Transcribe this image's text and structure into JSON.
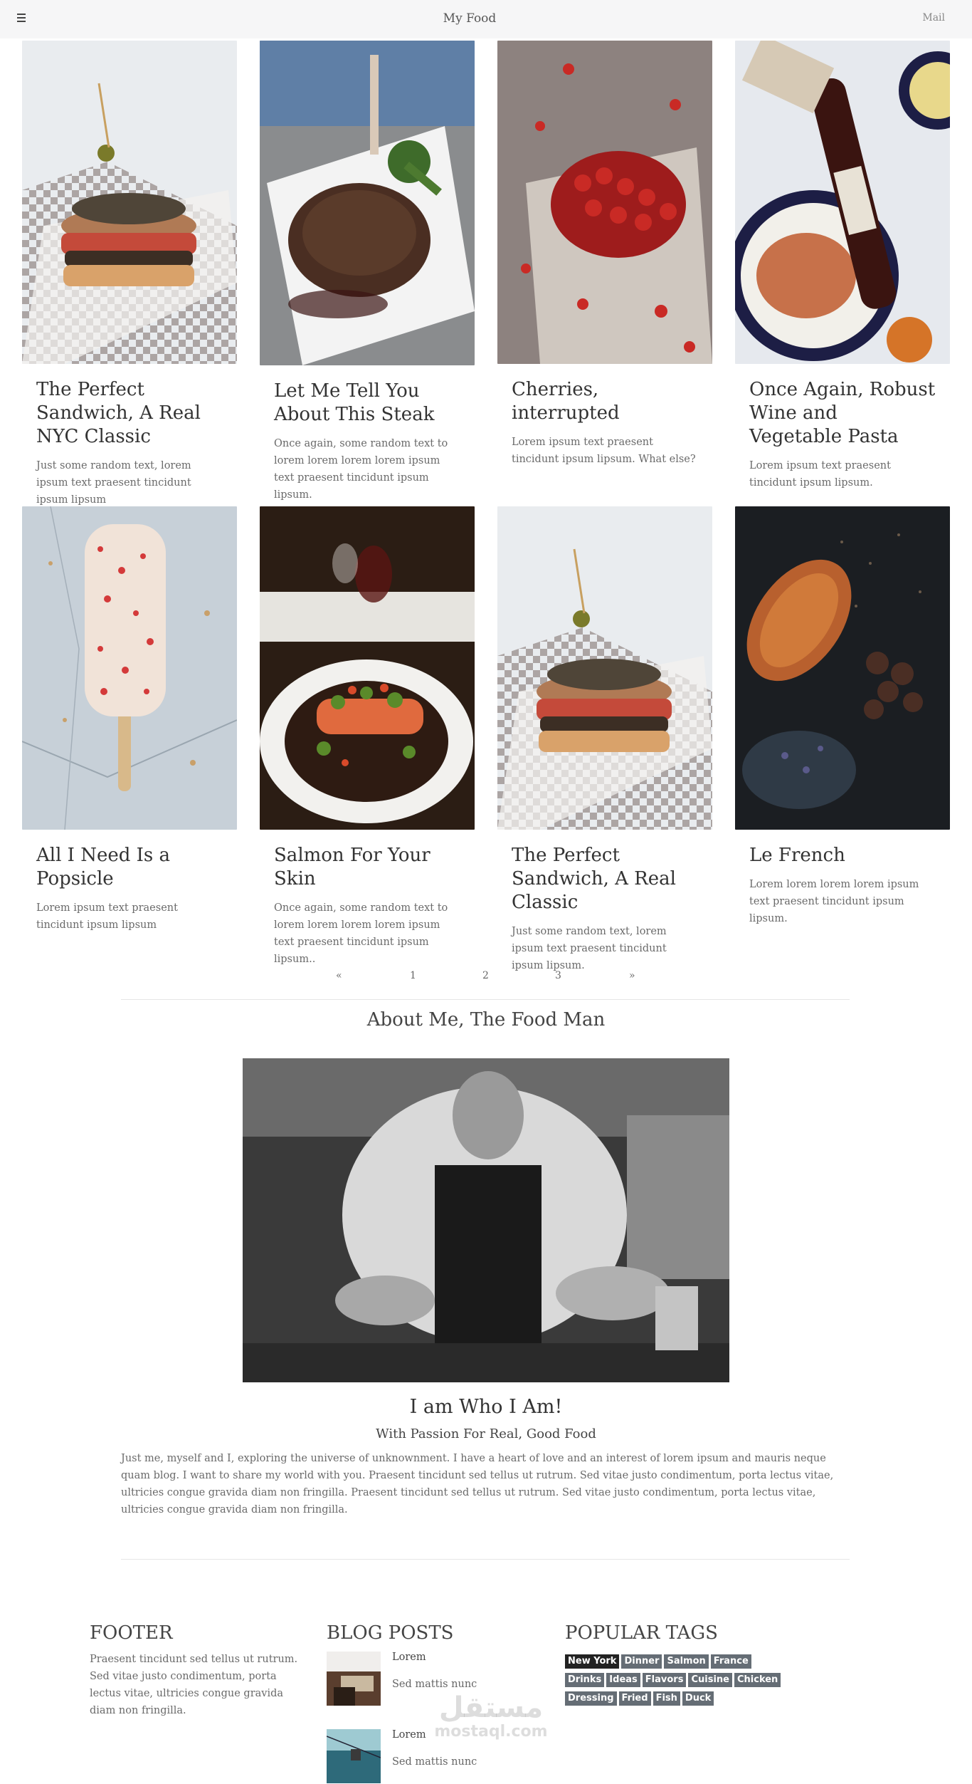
{
  "header": {
    "menu_icon": "hamburger-icon",
    "title": "My Food",
    "mail_label": "Mail"
  },
  "cards": [
    {
      "title": "The Perfect Sandwich, A Real NYC Classic",
      "text": "Just some random text, lorem ipsum text praesent tincidunt ipsum lipsum",
      "image": "sandwich"
    },
    {
      "title": "Let Me Tell You About This Steak",
      "text": "Once again, some random text to lorem lorem lorem lorem ipsum text praesent tincidunt ipsum lipsum.",
      "image": "steak"
    },
    {
      "title": "Cherries, interrupted",
      "text": "Lorem ipsum text praesent tincidunt ipsum lipsum. What else?",
      "image": "cherries"
    },
    {
      "title": "Once Again, Robust Wine and Vegetable Pasta",
      "text": "Lorem ipsum text praesent tincidunt ipsum lipsum.",
      "image": "wine-pasta"
    },
    {
      "title": "All I Need Is a Popsicle",
      "text": "Lorem ipsum text praesent tincidunt ipsum lipsum",
      "image": "popsicle"
    },
    {
      "title": "Salmon For Your Skin",
      "text": "Once again, some random text to lorem lorem lorem lorem ipsum text praesent tincidunt ipsum lipsum..",
      "image": "salmon"
    },
    {
      "title": "The Perfect Sandwich, A Real Classic",
      "text": "Just some random text, lorem ipsum text praesent tincidunt ipsum lipsum.",
      "image": "sandwich"
    },
    {
      "title": "Le French",
      "text": "Lorem lorem lorem lorem ipsum text praesent tincidunt ipsum lipsum.",
      "image": "croissant"
    }
  ],
  "pagination": {
    "prev": "«",
    "pages": [
      "1",
      "2",
      "3"
    ],
    "next": "»"
  },
  "about": {
    "title": "About Me, The Food Man",
    "image": "chef-photo",
    "heading": "I am Who I Am!",
    "subheading": "With Passion For Real, Good Food",
    "body": "Just me, myself and I, exploring the universe of unknownment. I have a heart of love and an interest of lorem ipsum and mauris neque quam blog. I want to share my world with you. Praesent tincidunt sed tellus ut rutrum. Sed vitae justo condimentum, porta lectus vitae, ultricies congue gravida diam non fringilla. Praesent tincidunt sed tellus ut rutrum. Sed vitae justo condimentum, porta lectus vitae, ultricies congue gravida diam non fringilla."
  },
  "footer": {
    "footer_title": "FOOTER",
    "footer_text": "Praesent tincidunt sed tellus ut rutrum. Sed vitae justo condimentum, porta lectus vitae, ultricies congue gravida diam non fringilla.",
    "blog_title": "BLOG POSTS",
    "posts": [
      {
        "title": "Lorem",
        "subtitle": "Sed mattis nunc"
      },
      {
        "title": "Lorem",
        "subtitle": "Sed mattis nunc"
      }
    ],
    "tags_title": "POPULAR TAGS",
    "tags": [
      "New York",
      "Dinner",
      "Salmon",
      "France",
      "Drinks",
      "Ideas",
      "Flavors",
      "Cuisine",
      "Chicken",
      "Dressing",
      "Fried",
      "Fish",
      "Duck"
    ]
  },
  "watermark": {
    "arabic": "مستقل",
    "latin": "mostaql.com"
  },
  "colors": {
    "topbar_bg": "#f6f6f7",
    "tag_bg": "#656d75",
    "tag_active_bg": "#222222"
  }
}
